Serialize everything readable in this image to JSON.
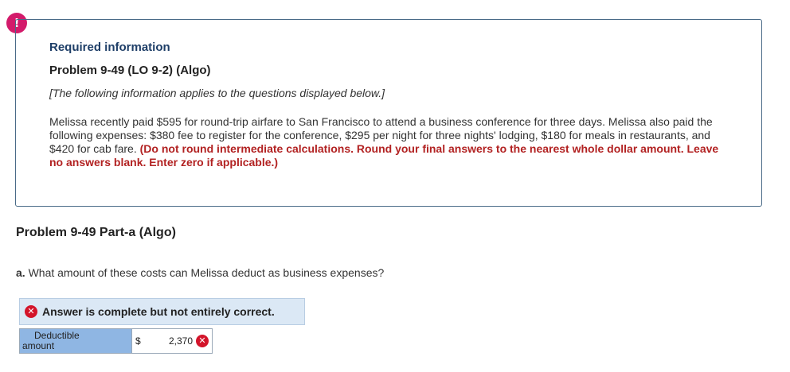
{
  "alert": {
    "icon": "exclamation-icon",
    "symbol": "!",
    "color": "#d31b6b"
  },
  "info": {
    "heading": "Required information",
    "problem_title": "Problem 9-49 (LO 9-2) (Algo)",
    "bracket_note": "[The following information applies to the questions displayed below.]",
    "body": "Melissa recently paid $595 for round-trip airfare to San Francisco to attend a business conference for three days. Melissa also paid the following expenses: $380 fee to register for the conference, $295 per night for three nights' lodging, $180 for meals in restaurants, and $420 for cab fare.",
    "instructions": "(Do not round intermediate calculations. Round your final answers to the nearest whole dollar amount. Leave no answers blank. Enter zero if applicable.)"
  },
  "part": {
    "title": "Problem 9-49 Part-a (Algo)",
    "question_letter": "a.",
    "question_text": "What amount of these costs can Melissa deduct as business expenses?"
  },
  "answer": {
    "status_icon": "x-circle-icon",
    "status_text": "Answer is complete but not entirely correct.",
    "label_line1": "Deductible",
    "label_line2": "amount",
    "currency": "$",
    "value": "2,370",
    "result_icon": "x-circle-icon",
    "result_symbol": "✕",
    "colors": {
      "incorrect": "#d3142a",
      "banner_bg": "#dbe8f5",
      "label_bg": "#8fb6e3"
    }
  }
}
